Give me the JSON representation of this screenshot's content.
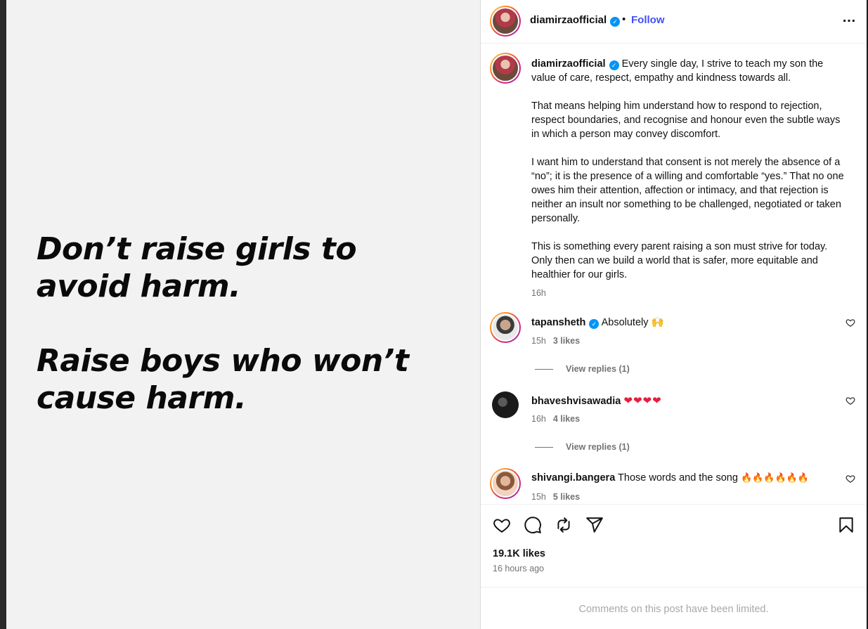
{
  "post": {
    "quote_line1": "Don’t raise girls to avoid harm.",
    "quote_line2": "Raise boys who won’t cause harm."
  },
  "header": {
    "username": "diamirzaofficial",
    "separator": "•",
    "follow_label": "Follow",
    "more_icon": "…"
  },
  "caption": {
    "username": "diamirzaofficial",
    "paragraph1": "Every single day, I strive to teach my son the value of care, respect, empathy and kindness towards all.",
    "paragraph2": "That means helping him understand how to respond to rejection, respect boundaries, and recognise and honour even the subtle ways in which a person may convey discomfort.",
    "paragraph3": "I want him to understand that consent is not merely the absence of a “no”; it is the presence of a willing and comfortable “yes.” That no one owes him their attention, affection or intimacy, and that rejection is neither an insult nor something to be challenged, negotiated or taken personally.",
    "paragraph4": "This is something every parent raising a son must strive for today. Only then can we build a world that is safer, more equitable and healthier for our girls.",
    "time": "16h"
  },
  "comments": [
    {
      "username": "tapansheth",
      "text": "Absolutely 🙌",
      "time": "15h",
      "likes": "3 likes",
      "replies": "View replies (1)"
    },
    {
      "username": "bhaveshvisawadia",
      "text": "❤❤❤❤",
      "time": "16h",
      "likes": "4 likes",
      "replies": "View replies (1)"
    },
    {
      "username": "shivangi.bangera",
      "text": "Those words and the song",
      "emoji": "🔥🔥🔥🔥🔥🔥",
      "time": "15h",
      "likes": "5 likes"
    }
  ],
  "footer": {
    "likes": "19.1K likes",
    "posted": "16 hours ago",
    "limited_notice": "Comments on this post have been limited."
  },
  "colors": {
    "follow": "#4150f7",
    "verified": "#0095f6",
    "heart_red": "#e41e3f",
    "secondary_text": "#737373"
  }
}
